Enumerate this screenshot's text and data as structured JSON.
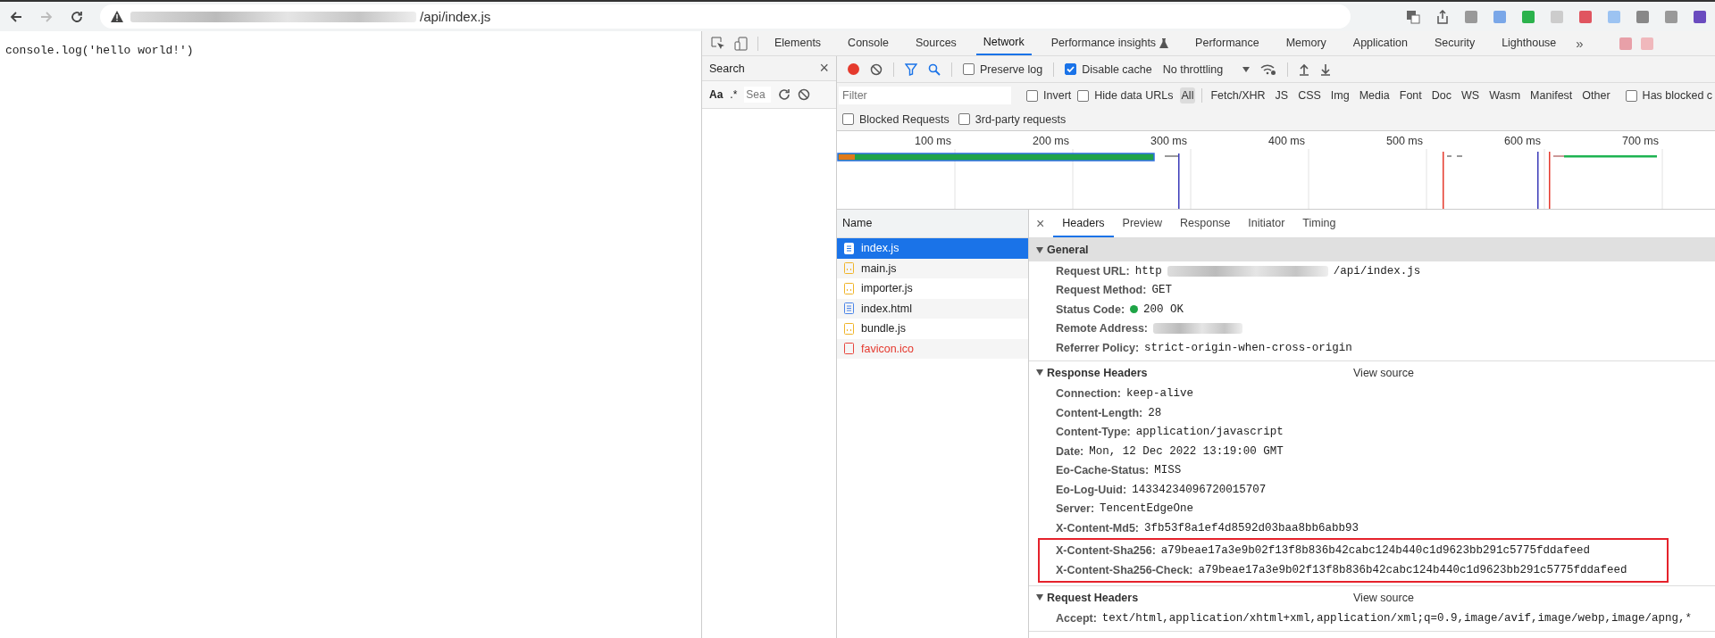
{
  "browser": {
    "url_end": "/api/index.js",
    "url_redacted": true,
    "forward_disabled": true
  },
  "page": {
    "text": "console.log('hello world!')"
  },
  "devtools_tabs": [
    {
      "label": "Elements",
      "selected": false
    },
    {
      "label": "Console",
      "selected": false
    },
    {
      "label": "Sources",
      "selected": false
    },
    {
      "label": "Network",
      "selected": true
    },
    {
      "label": "Performance insights",
      "selected": false,
      "experimental": true
    },
    {
      "label": "Performance",
      "selected": false
    },
    {
      "label": "Memory",
      "selected": false
    },
    {
      "label": "Application",
      "selected": false
    },
    {
      "label": "Security",
      "selected": false
    },
    {
      "label": "Lighthouse",
      "selected": false
    }
  ],
  "more_tabs": "»",
  "search_panel": {
    "title": "Search",
    "close": "×",
    "case_toggle": "Aa",
    "regex_toggle": ".*",
    "placeholder": "Sea"
  },
  "network_toolbar": {
    "recording": true,
    "options": [
      {
        "label": "Preserve log",
        "checked": false
      },
      {
        "label": "Disable cache",
        "checked": true
      }
    ],
    "throttling": "No throttling"
  },
  "filter_bar": {
    "placeholder": "Filter",
    "options": [
      {
        "label": "Invert",
        "checked": false
      },
      {
        "label": "Hide data URLs",
        "checked": false
      }
    ],
    "types": [
      {
        "label": "All",
        "selected": true
      },
      {
        "label": "Fetch/XHR",
        "selected": false
      },
      {
        "label": "JS",
        "selected": false
      },
      {
        "label": "CSS",
        "selected": false
      },
      {
        "label": "Img",
        "selected": false
      },
      {
        "label": "Media",
        "selected": false
      },
      {
        "label": "Font",
        "selected": false
      },
      {
        "label": "Doc",
        "selected": false
      },
      {
        "label": "WS",
        "selected": false
      },
      {
        "label": "Wasm",
        "selected": false
      },
      {
        "label": "Manifest",
        "selected": false
      },
      {
        "label": "Other",
        "selected": false
      }
    ],
    "trailing_option": {
      "label": "Has blocked c",
      "checked": false
    },
    "more_options": [
      {
        "label": "Blocked Requests",
        "checked": false
      },
      {
        "label": "3rd-party requests",
        "checked": false
      }
    ]
  },
  "timeline": {
    "ticks": [
      "100 ms",
      "200 ms",
      "300 ms",
      "400 ms",
      "500 ms",
      "600 ms",
      "700 ms"
    ]
  },
  "requests": {
    "column": "Name",
    "rows": [
      {
        "name": "index.js",
        "kind": "doc",
        "selected": true
      },
      {
        "name": "main.js",
        "kind": "script",
        "selected": false
      },
      {
        "name": "importer.js",
        "kind": "script",
        "selected": false
      },
      {
        "name": "index.html",
        "kind": "doc",
        "selected": false
      },
      {
        "name": "bundle.js",
        "kind": "script",
        "selected": false
      },
      {
        "name": "favicon.ico",
        "kind": "error",
        "selected": false
      }
    ]
  },
  "details": {
    "close": "×",
    "tabs": [
      {
        "label": "Headers",
        "selected": true
      },
      {
        "label": "Preview",
        "selected": false
      },
      {
        "label": "Response",
        "selected": false
      },
      {
        "label": "Initiator",
        "selected": false
      },
      {
        "label": "Timing",
        "selected": false
      }
    ],
    "sections": [
      {
        "title": "General",
        "expanded": true,
        "rows": [
          {
            "name": "Request URL:",
            "value": "http",
            "value_end": "/api/index.js",
            "redacted": true
          },
          {
            "name": "Request Method:",
            "value": "GET"
          },
          {
            "name": "Status Code:",
            "value": "200 OK",
            "color": "#1ea446"
          },
          {
            "name": "Remote Address:",
            "redacted": true
          },
          {
            "name": "Referrer Policy:",
            "value": "strict-origin-when-cross-origin"
          }
        ]
      },
      {
        "title": "Response Headers",
        "view_source": "View source",
        "expanded": true,
        "rows": [
          {
            "name": "Connection:",
            "value": "keep-alive"
          },
          {
            "name": "Content-Length:",
            "value": "28"
          },
          {
            "name": "Content-Type:",
            "value": "application/javascript"
          },
          {
            "name": "Date:",
            "value": "Mon, 12 Dec 2022 13:19:00 GMT"
          },
          {
            "name": "Eo-Cache-Status:",
            "value": "MISS"
          },
          {
            "name": "Eo-Log-Uuid:",
            "value": "14334234096720015707"
          },
          {
            "name": "Server:",
            "value": "TencentEdgeOne"
          },
          {
            "name": "X-Content-Md5:",
            "value": "3fb53f8a1ef4d8592d03baa8bb6abb93"
          }
        ],
        "boxed_rows": [
          {
            "name": "X-Content-Sha256:",
            "value": "a79beae17a3e9b02f13f8b836b42cabc124b440c1d9623bb291c5775fddafeed"
          },
          {
            "name": "X-Content-Sha256-Check:",
            "value": "a79beae17a3e9b02f13f8b836b42cabc124b440c1d9623bb291c5775fddafeed"
          }
        ]
      },
      {
        "title": "Request Headers",
        "view_source": "View source",
        "expanded": true,
        "rows": [
          {
            "name": "Accept:",
            "value": "text/html,application/xhtml+xml,application/xml;q=0.9,image/avif,image/webp,image/apng,*"
          }
        ]
      }
    ]
  }
}
